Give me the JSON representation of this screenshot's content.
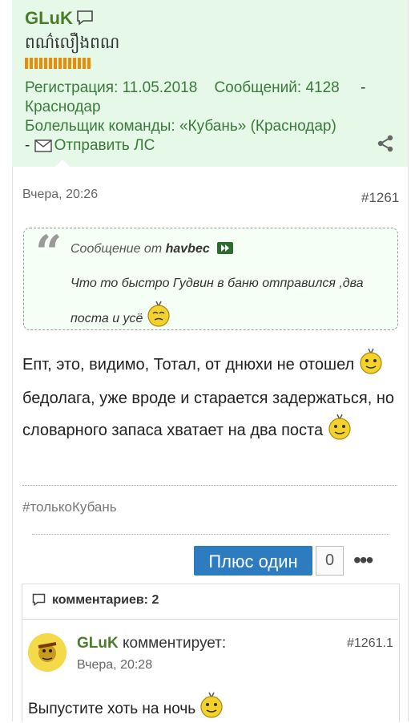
{
  "user": {
    "name": "GLuK",
    "title": "ពណ៌លឿងពណ",
    "reg_label": "Регистрация: 11.05.2018",
    "posts_label": "Сообщений: 4128",
    "sep": "-",
    "location": "Краснодар",
    "fan_label": "Болельщик команды: «Кубань» (Краснодар)",
    "pm_sep": "-",
    "pm_link": "Отправить ЛС",
    "rank_color": "#f08a00"
  },
  "post": {
    "date": "Вчера, 20:26",
    "number": "#1261",
    "quote": {
      "from_label": "Сообщение от",
      "author": "havbec",
      "text": "Что то быстро Гудвин в баню отправился ,два поста и усё"
    },
    "text_1": "Епт, это, видимо, Тотал, от днюхи не отошел",
    "text_2": "бедолага, уже вроде и старается задержаться, но словарного запаса хватает на два поста",
    "tag": "#толькоКубань",
    "plus_label": "Плюс один",
    "plus_count": "0"
  },
  "comments": {
    "header": "комментариев: 2",
    "items": [
      {
        "author": "GLuK",
        "action": "комментирует:",
        "number": "#1261.1",
        "date": "Вчера, 20:28",
        "text": "Выпустите хоть на ночь"
      }
    ]
  },
  "icons": {
    "chat": "speech-bubble-icon",
    "envelope": "envelope-icon",
    "share": "share-icon",
    "go": "go-to-post-icon",
    "more": "more-options-icon",
    "comment": "comment-icon",
    "smiley": "smiley-icon"
  }
}
